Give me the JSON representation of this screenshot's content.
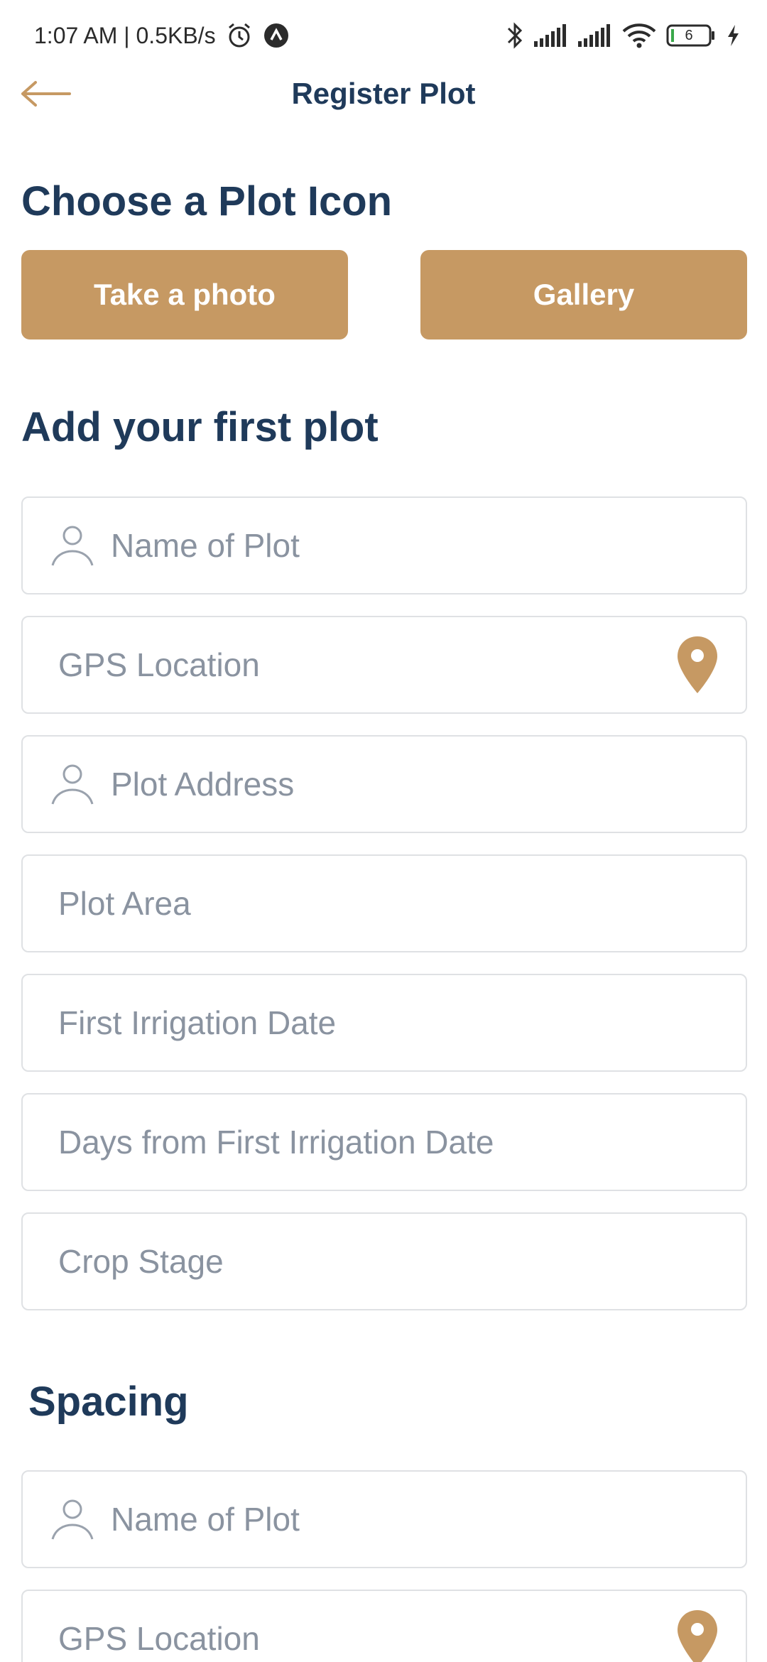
{
  "status_bar": {
    "time_speed": "1:07 AM | 0.5KB/s",
    "battery_level": "6",
    "icons": [
      "alarm-icon",
      "app-notification-icon",
      "bluetooth-icon",
      "signal-icon",
      "signal-icon",
      "wifi-icon",
      "battery-icon",
      "charging-icon"
    ]
  },
  "app_bar": {
    "title": "Register Plot",
    "back_icon": "back-arrow-icon"
  },
  "plot_icon_section": {
    "title": "Choose a Plot Icon",
    "take_photo_label": "Take a photo",
    "gallery_label": "Gallery"
  },
  "first_plot_section": {
    "title": "Add your first plot",
    "fields": {
      "name": "Name of Plot",
      "gps": "GPS Location",
      "address": "Plot Address",
      "area": "Plot Area",
      "irrigation_date": "First Irrigation Date",
      "days_from_irrigation": "Days from First Irrigation Date",
      "crop_stage": "Crop Stage"
    }
  },
  "spacing_section": {
    "title": "Spacing",
    "fields": {
      "name": "Name of Plot",
      "gps": "GPS Location"
    }
  },
  "colors": {
    "accent": "#c69963",
    "title": "#1f3a5a",
    "placeholder": "#8a93a0",
    "border": "#dfe1e4"
  }
}
